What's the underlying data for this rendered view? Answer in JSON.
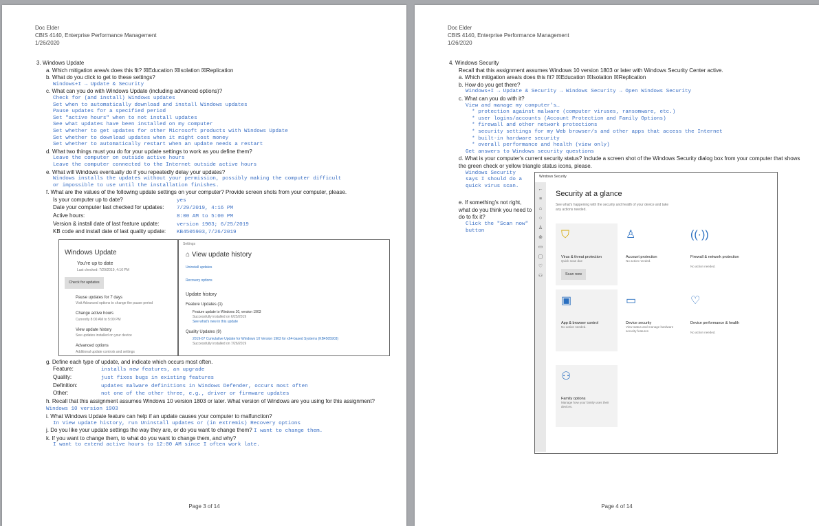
{
  "p3": {
    "hdr": [
      "Doc Elder",
      "CBIS 4140, Enterprise Performance Management",
      "1/26/2020"
    ],
    "q3": "3.  Windows Update",
    "a": "a.  Which mitigation area/s does this fit? ☒Education ☒Isolation ☒Replication",
    "b": "b.  What do you click to get to these settings?",
    "b_ans": "Windows+I → Update & Security",
    "c": "c.  What can you do with Windows Update (including advanced options)?",
    "c_ans": "Check for (and install) Windows updates\nSet when to automatically download and install Windows updates\nPause updates for a specified period\nSet \"active hours\" when to not install updates\nSee what updates have been installed on my computer\nSet whether to get updates for other Microsoft products with Windows Update\nSet whether to download updates when it might cost money\nSet whether to automatically restart when an update needs a restart",
    "d": "d.  What two things must you do for your update settings to work as you define them?",
    "d_ans": "Leave the computer on outside active hours\nLeave the computer connected to the Internet outside active hours",
    "e": "e.  What will Windows eventually do if you repeatedly delay your updates?",
    "e_ans": "Windows installs the updates without your permission, possibly making the computer difficult\nor impossible to use until the installation finishes.",
    "f": "f.   What are the values of the following update settings on your computer? Provide screen shots from your computer, please.",
    "f_rows": [
      [
        "Is your computer up to date?",
        "yes"
      ],
      [
        "Date your computer last checked for updates:",
        "7/29/2019, 4:16 PM"
      ],
      [
        "Active hours:",
        "8:00 AM to 5:00 PM"
      ],
      [
        "Version & install date of last feature update:",
        "version 1903; 6/25/2019"
      ],
      [
        "KB code and install date of last quality update:",
        "KB4505903,7/26/2019"
      ]
    ],
    "wu": {
      "title": "Windows Update",
      "status": "You're up to date",
      "checked": "Last checked: 7/29/2019, 4:16 PM",
      "btn": "Check for updates",
      "opts": [
        [
          "Pause updates for 7 days",
          "Visit Advanced options to change the pause period"
        ],
        [
          "Change active hours",
          "Currently 8:00 AM to 5:00 PM"
        ],
        [
          "View update history",
          "See updates installed on your device"
        ],
        [
          "Advanced options",
          "Additional update controls and settings"
        ]
      ]
    },
    "vh": {
      "app": "Settings",
      "title": "View update history",
      "l1": "Uninstall updates",
      "l2": "Recovery options",
      "h": "Update history",
      "fu": "Feature Updates (1)",
      "fu1": "Feature update to Windows 10, version 1903",
      "fu2": "Successfully installed on 6/25/2019",
      "fu3": "See what's new in this update",
      "qu": "Quality Updates (9)",
      "qu1": "2019-07 Cumulative Update for Windows 10 Version 1903 for x64-based Systems (KB4505903)",
      "qu2": "Successfully installed on 7/26/2019"
    },
    "g": "g.  Define each type of update, and indicate which occurs most often.",
    "g_rows": [
      [
        "Feature:",
        "installs new features, an upgrade"
      ],
      [
        "Quality:",
        "just fixes bugs in existing features"
      ],
      [
        "Definition:",
        "updates malware definitions in Windows Defender, occurs most often"
      ],
      [
        "Other:",
        "not one of the other three, e.g., driver or firmware updates"
      ]
    ],
    "h": "h.  Recall that this assignment assumes Windows 10 version 1803 or later. What version of Windows are you using for this assignment?",
    "h_ans": "Windows 10 version 1903",
    "i": "i.   What Windows Update feature can help if an update causes your computer to malfunction?",
    "i_ans": "In View update history, run Uninstall updates or (in extremis) Recovery options",
    "j": "j.   Do you like your update settings the way they are, or do you want to change them?",
    "j_ans": "I want to change them.",
    "k": "k.  If you want to change them, to what do you want to change them, and why?",
    "k_ans": "I want to extend active hours to 12:00 AM since I often work late.",
    "foot": "Page 3 of 14"
  },
  "p4": {
    "hdr": [
      "Doc Elder",
      "CBIS 4140, Enterprise Performance Management",
      "1/26/2020"
    ],
    "q4": "4.  Windows Security",
    "intro": "Recall that this assignment assumes Windows 10 version 1803 or later with Windows Security Center active.",
    "a": "a.  Which mitigation area/s does this fit? ☒Education ☒Isolation ☒Replication",
    "b": "b.  How do you get there?",
    "b_ans": "Windows+I → Update & Security → Windows Security → Open Windows Security",
    "c": "c.  What can you do with it?",
    "c_ans": "View and manage my computer's…\n  * protection against malware (computer viruses, ransomware, etc.)\n  * user logins/accounts (Account Protection and Family Options)\n  * firewall and other network protections\n  * security settings for my Web browser/s and other apps that access the Internet\n  * built-in hardware security\n  * overall performance and health (view only)\nGet answers to Windows security questions",
    "d": "d.  What is your computer's current security status? Include a screen shot of the Windows Security dialog box from your computer that shows the green check or yellow triangle status icons, please.",
    "d_ans": "Windows Security\nsays I should do a\nquick virus scan.",
    "e": "e.  If something's not right, what do you think you need to do to fix it?",
    "e_ans": "Click the \"Scan now\"\nbutton",
    "ws": {
      "app": "Windows Security",
      "title": "Security at a glance",
      "sub": "See what's happening with the security and health of your device and take any actions needed.",
      "scan": "Scan now",
      "tiles": [
        [
          "Virus & threat protection",
          "Quick scan due"
        ],
        [
          "Account protection",
          "No action needed."
        ],
        [
          "Firewall & network protection",
          "No action needed."
        ],
        [
          "App & browser control",
          "No action needed."
        ],
        [
          "Device security",
          "View status and manage hardware security features"
        ],
        [
          "Device performance & health",
          "No action needed."
        ],
        [
          "Family options",
          "Manage how your family uses their devices."
        ]
      ]
    },
    "foot": "Page 4 of 14"
  }
}
